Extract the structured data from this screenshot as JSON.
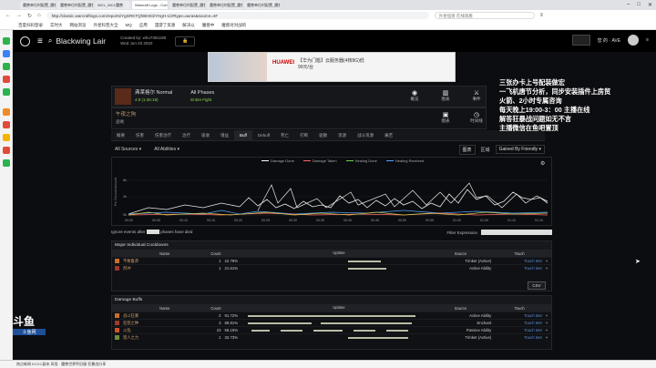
{
  "browser": {
    "tabs": [
      "魔兽单位时配置_魔兽对对战的",
      "魔兽单位时配置_魔兽对对战的",
      "WCL_WCL魔兽",
      "Warcraft Logs - Combat A",
      "魔兽单位时配置_魔兽对对战的",
      "魔兽单位时配置_魔兽对对战的",
      "魔兽单位时配置_魔兽对对战的"
    ],
    "url": "http://classic.warcraftlogs.com/reports/YgGRKTQhBHKl2YHgH-1/2#type=auras&source=4#",
    "search_placeholder": "外星怪兽 在线观看",
    "bookmarks": [
      "百度扫码登录",
      "实时大",
      "网站浏览",
      "外星科普大全",
      "MQ",
      "应用",
      "漫游了资源",
      "解决以",
      "魔兽中",
      "魔兽对对战的"
    ]
  },
  "site": {
    "report_title": "Blackwing Lair",
    "created_by": "Created by: who7361189",
    "date": "Wed Jun 03 2020",
    "lock_label": "🔒",
    "right_user": "我心 AVE",
    "right_region": "您 的 · AVE"
  },
  "ad": {
    "brand": "HUAWEI",
    "line1": "【华为门槛】云服务器(4核8G)低",
    "line2": "99元/台"
  },
  "fight": {
    "boss": "弗莱格尔 Normal",
    "boss_sub": "4:8 (1:36:19)",
    "phase": "All Phases",
    "phase_sub": "Entire Fight",
    "views": [
      {
        "label": "概览",
        "glyph": "◉"
      },
      {
        "label": "图表",
        "glyph": "▥"
      },
      {
        "label": "事件",
        "glyph": "⚔"
      }
    ],
    "player": "午夜之狗",
    "player_class": "盗贼",
    "sub_views": [
      {
        "label": "图表",
        "glyph": "▣"
      },
      {
        "label": "时间线",
        "glyph": "◷"
      }
    ]
  },
  "nav": {
    "tabs": [
      "概要",
      "伤害",
      "伤害治疗",
      "治疗",
      "吸收",
      "增益",
      "Buff",
      "Debuff",
      "死亡",
      "打断",
      "驱散",
      "资源",
      "战斗资源",
      "痛苦"
    ],
    "active_index": 6
  },
  "filters": {
    "sources": "All Sources",
    "abilities": "All Abilities",
    "right_a": "图表",
    "right_b": "区域",
    "scope": "Gained By Friendly"
  },
  "chart": {
    "legend": [
      {
        "name": "Damage Done",
        "color": "#ffffff"
      },
      {
        "name": "Damage Taken",
        "color": "#ff6666"
      },
      {
        "name": "Healing Done",
        "color": "#6ccf4e"
      },
      {
        "name": "Healing Received",
        "color": "#4ea3ff"
      }
    ],
    "ylabel": "Per Second Amount",
    "yticks": [
      "6k",
      "2k",
      "0k"
    ],
    "xticks": [
      "00:00",
      "00:05",
      "00:10",
      "00:15",
      "00:20",
      "00:25",
      "00:30",
      "00:35",
      "00:40",
      "00:45",
      "00:50",
      "00:55",
      "01:00",
      "01:05",
      "01:10",
      "01:15"
    ]
  },
  "ignore": {
    "before": "Ignore events after",
    "after": "phases have died",
    "filter_label": "Filter Expression"
  },
  "cooldowns": {
    "title": "Major Individual Cooldowns",
    "headers": [
      "Name",
      "Count",
      "Uptime",
      "Source",
      "Touch"
    ],
    "rows": [
      {
        "name": "不要鲁莽",
        "count": "1",
        "pct": "22.78%",
        "source": "Trinket (Active)",
        "touch": "Touch Me!",
        "bars": [
          [
            0.55,
            0.73
          ]
        ],
        "color": "#c86f2c"
      },
      {
        "name": "剂冲",
        "count": "1",
        "pct": "21.61%",
        "source": "Active Ability",
        "touch": "Touch Me!",
        "bars": [
          [
            0.55,
            0.76
          ]
        ],
        "color": "#a5322a"
      }
    ],
    "csv": "CSV"
  },
  "buffs": {
    "title": "Damage Buffs",
    "headers": [
      "Name",
      "Count",
      "Uptime",
      "Source",
      "Touch"
    ],
    "rows": [
      {
        "name": "战斗狂暴",
        "count": "2",
        "pct": "91.72%",
        "source": "Active Ability",
        "touch": "Touch Me!",
        "bars": [
          [
            0.0,
            0.92
          ]
        ],
        "color": "#c86f2c"
      },
      {
        "name": "狂怒之种",
        "count": "3",
        "pct": "89.81%",
        "source": "Enchant",
        "touch": "Touch Me!",
        "bars": [
          [
            0.0,
            0.35
          ],
          [
            0.4,
            0.9
          ]
        ],
        "color": "#9d3a2c"
      },
      {
        "name": "火焰",
        "count": "23",
        "pct": "59.16%",
        "source": "Passive Ability",
        "touch": "Touch Me!",
        "bars": [
          [
            0.02,
            0.12
          ],
          [
            0.18,
            0.3
          ],
          [
            0.36,
            0.52
          ],
          [
            0.58,
            0.7
          ],
          [
            0.76,
            0.88
          ]
        ],
        "color": "#d0532c"
      },
      {
        "name": "猎人之力",
        "count": "1",
        "pct": "32.73%",
        "source": "Trinket (Active)",
        "touch": "Touch Me!",
        "bars": [
          [
            0.55,
            0.88
          ]
        ],
        "color": "#6b8e3a"
      }
    ]
  },
  "overlay": {
    "lines": [
      "三张办卡上号配装做宏",
      "一飞机唐节分析，同步安装插件上房贸",
      "火箭、2小时专属咨询",
      "每天晚上19:00-3：00 主播在线",
      "解答狂暴战问题如无不言",
      "主播微信在鱼吧置顶"
    ]
  },
  "watermark": {
    "big": "斗鱼",
    "small": "斗鱼网"
  },
  "taskbar": {
    "text": "热点新闻 ECCC副本 风怪 · 魔兽世界怀旧服 狂暴战分享"
  }
}
